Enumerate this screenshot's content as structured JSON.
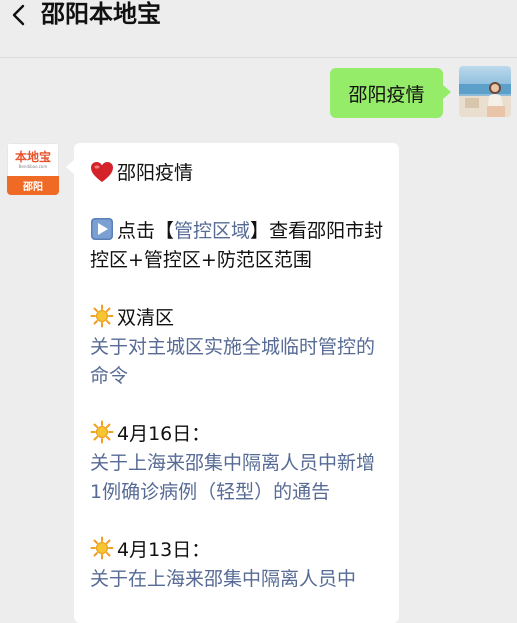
{
  "header": {
    "back_icon": "chevron-left-icon",
    "title": "邵阳本地宝"
  },
  "outgoing": {
    "text": "邵阳疫情"
  },
  "bot_avatar": {
    "brand": "本地宝",
    "site": "Bendibao.com",
    "city": "邵阳"
  },
  "incoming": {
    "heading_icon": "heart-icon",
    "heading": "邵阳疫情",
    "play_icon": "play-button-icon",
    "tip_prefix": "点击",
    "tip_bracket_open": "【",
    "tip_link": "管控区域",
    "tip_bracket_close": "】",
    "tip_suffix": "查看邵阳市封控区+管控区+防范区范围",
    "sections": [
      {
        "icon": "sun-icon",
        "label": "双清区",
        "link": "关于对主城区实施全城临时管控的命令"
      },
      {
        "icon": "sun-icon",
        "label": "4月16日：",
        "link": "关于上海来邵集中隔离人员中新增1例确诊病例（轻型）的通告"
      },
      {
        "icon": "sun-icon",
        "label": "4月13日：",
        "link": "关于在上海来邵集中隔离人员中"
      }
    ]
  },
  "colors": {
    "background": "#ededed",
    "outgoing_bubble": "#95ec69",
    "incoming_bubble": "#ffffff",
    "link": "#576b95",
    "brand_orange": "#ef6a25"
  }
}
